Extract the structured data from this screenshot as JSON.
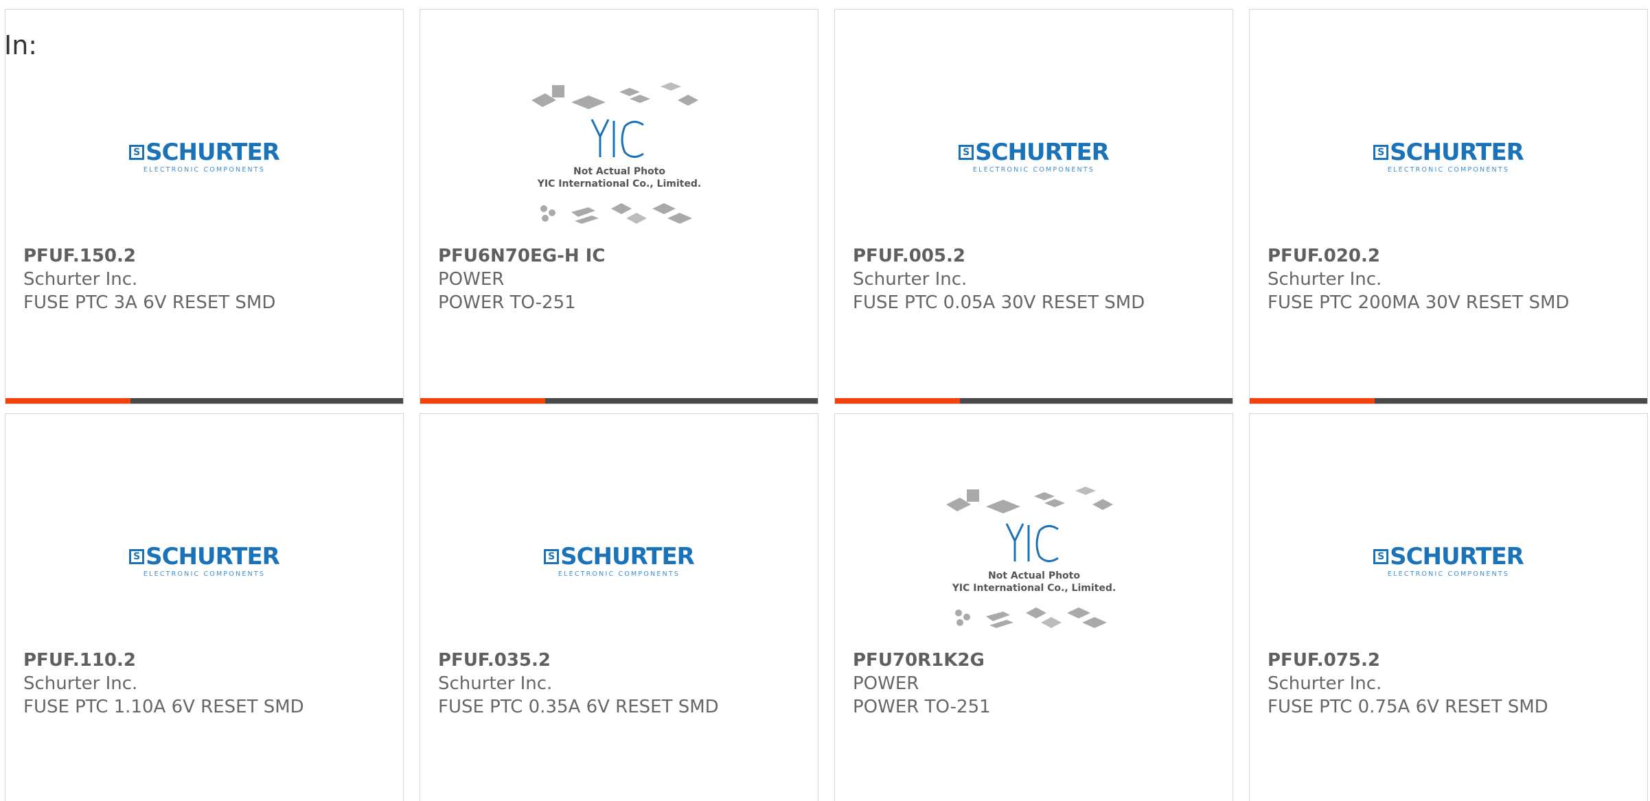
{
  "filter": {
    "label": "In:"
  },
  "cards": [
    {
      "part": "PFUF.150.2",
      "maker": "Schurter Inc.",
      "desc": "FUSE PTC 3A 6V RESET SMD",
      "image": "schurter-logo"
    },
    {
      "part": "PFU6N70EG-H IC",
      "maker": "POWER",
      "desc": "POWER TO-251",
      "image": "yic-placeholder"
    },
    {
      "part": "PFUF.005.2",
      "maker": "Schurter Inc.",
      "desc": "FUSE PTC 0.05A 30V RESET SMD",
      "image": "schurter-logo"
    },
    {
      "part": "PFUF.020.2",
      "maker": "Schurter Inc.",
      "desc": "FUSE PTC 200MA 30V RESET SMD",
      "image": "schurter-logo"
    },
    {
      "part": "PFUF.110.2",
      "maker": "Schurter Inc.",
      "desc": "FUSE PTC 1.10A 6V RESET SMD",
      "image": "schurter-logo"
    },
    {
      "part": "PFUF.035.2",
      "maker": "Schurter Inc.",
      "desc": "FUSE PTC 0.35A 6V RESET SMD",
      "image": "schurter-logo"
    },
    {
      "part": "PFU70R1K2G",
      "maker": "POWER",
      "desc": "POWER TO-251",
      "image": "yic-placeholder"
    },
    {
      "part": "PFUF.075.2",
      "maker": "Schurter Inc.",
      "desc": "FUSE PTC 0.75A 6V RESET SMD",
      "image": "schurter-logo"
    }
  ],
  "logos": {
    "schurter": {
      "mark": "S",
      "word": "SCHURTER",
      "tagline": "ELECTRONIC COMPONENTS"
    },
    "yic": {
      "mark": "YIC",
      "line1": "Not Actual Photo",
      "line2": "YIC International Co., Limited."
    }
  },
  "colors": {
    "accent": "#f2430f",
    "bar": "#4a4a4a",
    "brand_blue": "#1a73b8"
  }
}
